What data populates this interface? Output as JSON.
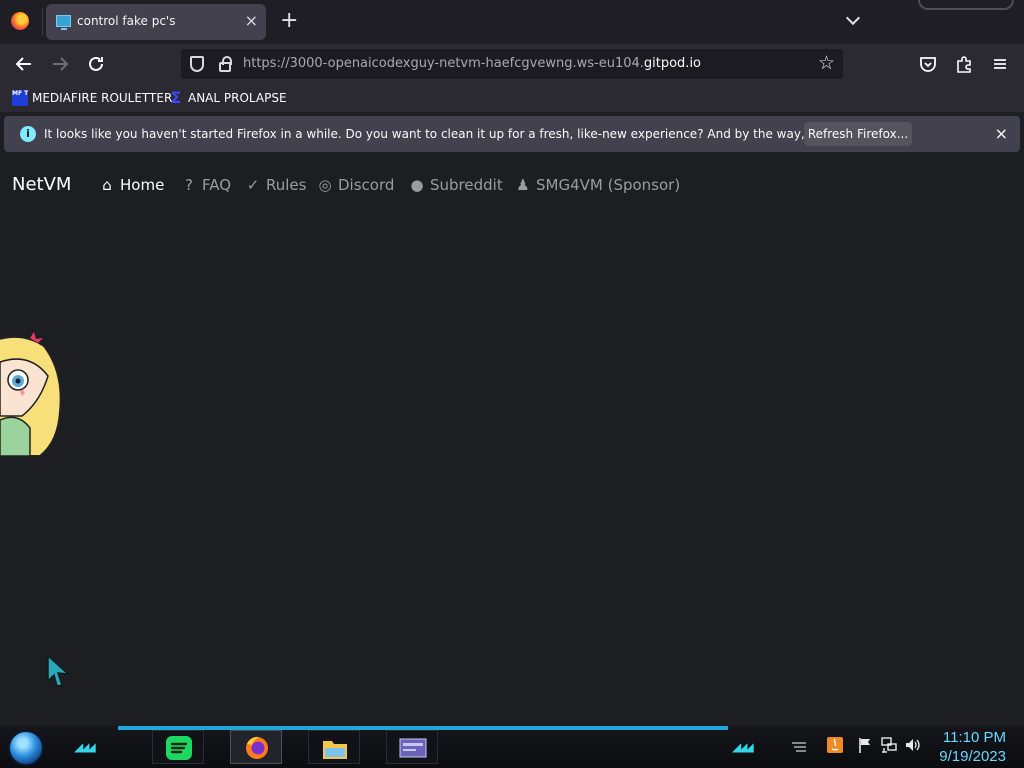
{
  "browser": {
    "tab": {
      "title": "control fake pc's",
      "close": "×"
    },
    "new_tab": "+",
    "url": {
      "prefix": "https://3000-openaicodexguy-netvm-haefcgvewng.ws-eu104.",
      "host": "gitpod.io"
    },
    "bookmarks": [
      {
        "label": "MEDIAFIRE ROULETTER",
        "icon": "mediafire-icon",
        "icon_text": "MF T"
      },
      {
        "label": "ANAL PROLAPSE",
        "icon": "sigma-icon",
        "icon_text": "Σ"
      }
    ],
    "notification": {
      "info_glyph": "i",
      "message": "It looks like you haven't started Firefox in a while. Do you want to clean it up for a fresh, like-new experience? And by the way, welcome back!",
      "button": "Refresh Firefox...",
      "close": "×"
    }
  },
  "site": {
    "brand": "NetVM",
    "nav": [
      {
        "label": "Home",
        "icon": "home-icon",
        "glyph": "⌂",
        "active": true
      },
      {
        "label": "FAQ",
        "icon": "question-icon",
        "glyph": "?",
        "active": false
      },
      {
        "label": "Rules",
        "icon": "clipboard-check-icon",
        "glyph": "✓",
        "active": false
      },
      {
        "label": "Discord",
        "icon": "discord-icon",
        "glyph": "◎",
        "active": false
      },
      {
        "label": "Subreddit",
        "icon": "reddit-icon",
        "glyph": "●",
        "active": false
      },
      {
        "label": "SMG4VM (Sponsor)",
        "icon": "user-icon",
        "glyph": "♟",
        "active": false
      }
    ]
  },
  "taskbar": {
    "apps": [
      "spotify-icon",
      "firefox-icon",
      "file-explorer-icon",
      "remote-window-icon"
    ],
    "clock": {
      "time": "11:10 PM",
      "date": "9/19/2023"
    },
    "colors": {
      "accent": "#1ea7d8",
      "clock": "#6fd6ff"
    }
  }
}
